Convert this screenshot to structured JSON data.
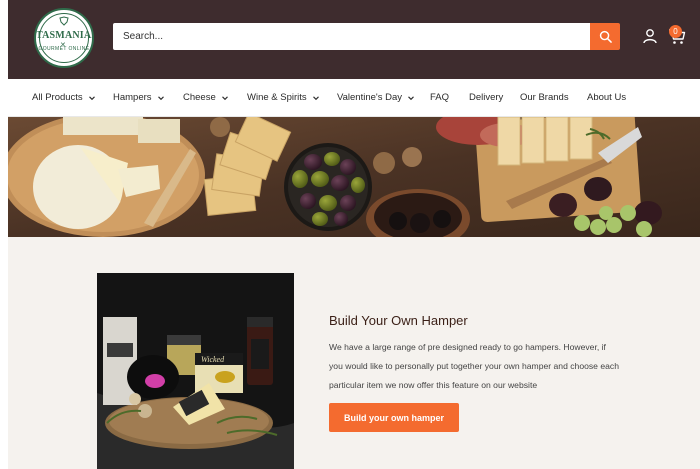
{
  "logo": {
    "text": "TASMANIAN",
    "subtext": "GOURMET ONLINE"
  },
  "search": {
    "placeholder": "Search..."
  },
  "header_icons": {
    "account": "user-icon",
    "cart": "cart-icon",
    "cart_count": "0"
  },
  "nav": {
    "items": [
      {
        "label": "All Products",
        "dropdown": true
      },
      {
        "label": "Hampers",
        "dropdown": true
      },
      {
        "label": "Cheese",
        "dropdown": true
      },
      {
        "label": "Wine & Spirits",
        "dropdown": true
      },
      {
        "label": "Valentine's Day",
        "dropdown": true
      },
      {
        "label": "FAQ",
        "dropdown": false
      },
      {
        "label": "Delivery",
        "dropdown": false
      },
      {
        "label": "Our Brands",
        "dropdown": false
      },
      {
        "label": "About Us",
        "dropdown": false
      }
    ]
  },
  "feature": {
    "title": "Build Your Own Hamper",
    "body": "We have a large range of pre designed ready to go hampers. However, if you would like to personally put together your own hamper and choose each particular item we now offer this feature on our website",
    "button_label": "Build your own hamper",
    "product_label": "Wicked"
  },
  "colors": {
    "header_bg": "#3e2c2e",
    "accent": "#f46b2f",
    "content_bg": "#f5f2ee"
  }
}
